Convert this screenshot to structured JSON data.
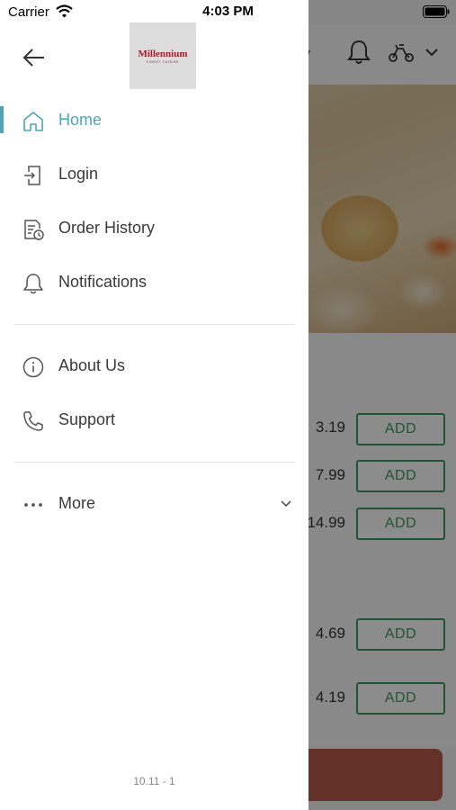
{
  "status_bar": {
    "carrier": "Carrier",
    "time": "4:03 PM"
  },
  "background_app": {
    "header_title_fragment": "y",
    "items": [
      {
        "price": "3.19",
        "add_label": "ADD"
      },
      {
        "price": "7.99",
        "add_label": "ADD"
      },
      {
        "price": "14.99",
        "add_label": "ADD"
      },
      {
        "price": "4.69",
        "add_label": "ADD"
      },
      {
        "price": "4.19",
        "add_label": "ADD"
      }
    ]
  },
  "drawer": {
    "logo": {
      "name": "Millennium",
      "tagline": "FINEST CUISINE"
    },
    "menu_primary": [
      {
        "label": "Home",
        "icon": "home-icon",
        "active": true
      },
      {
        "label": "Login",
        "icon": "login-icon",
        "active": false
      },
      {
        "label": "Order History",
        "icon": "order-history-icon",
        "active": false
      },
      {
        "label": "Notifications",
        "icon": "bell-icon",
        "active": false
      }
    ],
    "menu_secondary": [
      {
        "label": "About Us",
        "icon": "info-icon"
      },
      {
        "label": "Support",
        "icon": "phone-icon"
      }
    ],
    "more": {
      "label": "More",
      "icon": "ellipsis-icon"
    },
    "version": "10.11 - 1"
  },
  "colors": {
    "accent": "#4fa4b6",
    "add_button": "#3c9a5c",
    "cart_bar": "#b45a48",
    "overlay": "rgba(0,0,0,0.45)"
  }
}
